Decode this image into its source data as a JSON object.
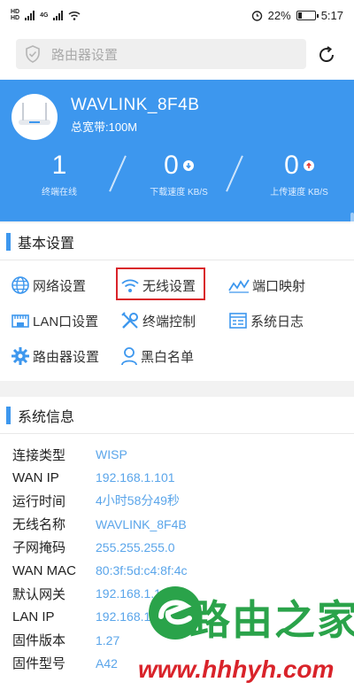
{
  "status_bar": {
    "battery": "22%",
    "time": "5:17",
    "network_gen": "4G",
    "hd": "HD"
  },
  "search": {
    "placeholder": "路由器设置"
  },
  "device": {
    "name": "WAVLINK_8F4B",
    "bandwidth": "总宽带:100M"
  },
  "stats": [
    {
      "value": "1",
      "label": "终端在线"
    },
    {
      "value": "0",
      "label": "下载速度 KB/S"
    },
    {
      "value": "0",
      "label": "上传速度 KB/S"
    }
  ],
  "basic": {
    "title": "基本设置",
    "items": {
      "network": "网络设置",
      "wireless": "无线设置",
      "port_mapping": "端口映射",
      "lan": "LAN口设置",
      "terminal": "终端控制",
      "syslog": "系统日志",
      "router": "路由器设置",
      "blacklist": "黑白名单"
    }
  },
  "system": {
    "title": "系统信息",
    "rows": [
      {
        "k": "连接类型",
        "v": "WISP"
      },
      {
        "k": "WAN IP",
        "v": "192.168.1.101"
      },
      {
        "k": "运行时间",
        "v": "4小时58分49秒"
      },
      {
        "k": "无线名称",
        "v": "WAVLINK_8F4B"
      },
      {
        "k": "子网掩码",
        "v": "255.255.255.0"
      },
      {
        "k": "WAN MAC",
        "v": "80:3f:5d:c4:8f:4c"
      },
      {
        "k": "默认网关",
        "v": "192.168.1.1"
      },
      {
        "k": "LAN IP",
        "v": "192.168.1.1"
      },
      {
        "k": "固件版本",
        "v": "1.27"
      },
      {
        "k": "固件型号",
        "v": "A42"
      }
    ]
  },
  "watermark": {
    "brand": "路由之家",
    "url": "www.hhhyh.com"
  },
  "colors": {
    "accent": "#3d97ee",
    "value_text": "#5aa5ea",
    "highlight": "#d9232a"
  }
}
